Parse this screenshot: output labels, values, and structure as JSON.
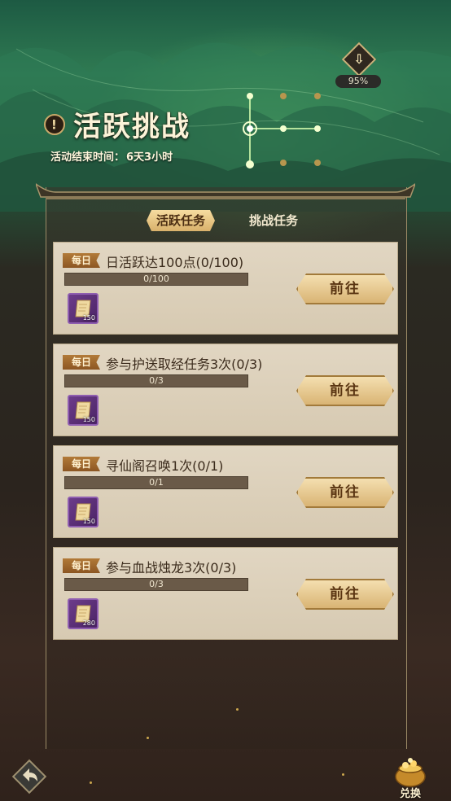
{
  "header": {
    "title": "活跃挑战",
    "title_mark": "!",
    "end_time_label": "活动结束时间：",
    "end_time_value": "6天3小时",
    "progress_percent": "95%"
  },
  "tabs": [
    {
      "label": "活跃任务",
      "active": true
    },
    {
      "label": "挑战任务",
      "active": false
    }
  ],
  "tasks": [
    {
      "tag": "每日",
      "name": "日活跃达100点(0/100)",
      "progress_text": "0/100",
      "progress": 0,
      "reward_qty": "150",
      "button": "前往"
    },
    {
      "tag": "每日",
      "name": "参与护送取经任务3次(0/3)",
      "progress_text": "0/3",
      "progress": 0,
      "reward_qty": "150",
      "button": "前往"
    },
    {
      "tag": "每日",
      "name": "寻仙阁召唤1次(0/1)",
      "progress_text": "0/1",
      "progress": 0,
      "reward_qty": "150",
      "button": "前往"
    },
    {
      "tag": "每日",
      "name": "参与血战烛龙3次(0/3)",
      "progress_text": "0/3",
      "progress": 0,
      "reward_qty": "280",
      "button": "前往"
    }
  ],
  "footer": {
    "exchange_label": "兑换",
    "back_icon": "back-arrow-icon",
    "exchange_icon": "treasure-pot-icon"
  },
  "colors": {
    "accent_gold": "#d9b474",
    "panel_bg": "#ddd2bd",
    "daily_tag": "#9c6328"
  }
}
